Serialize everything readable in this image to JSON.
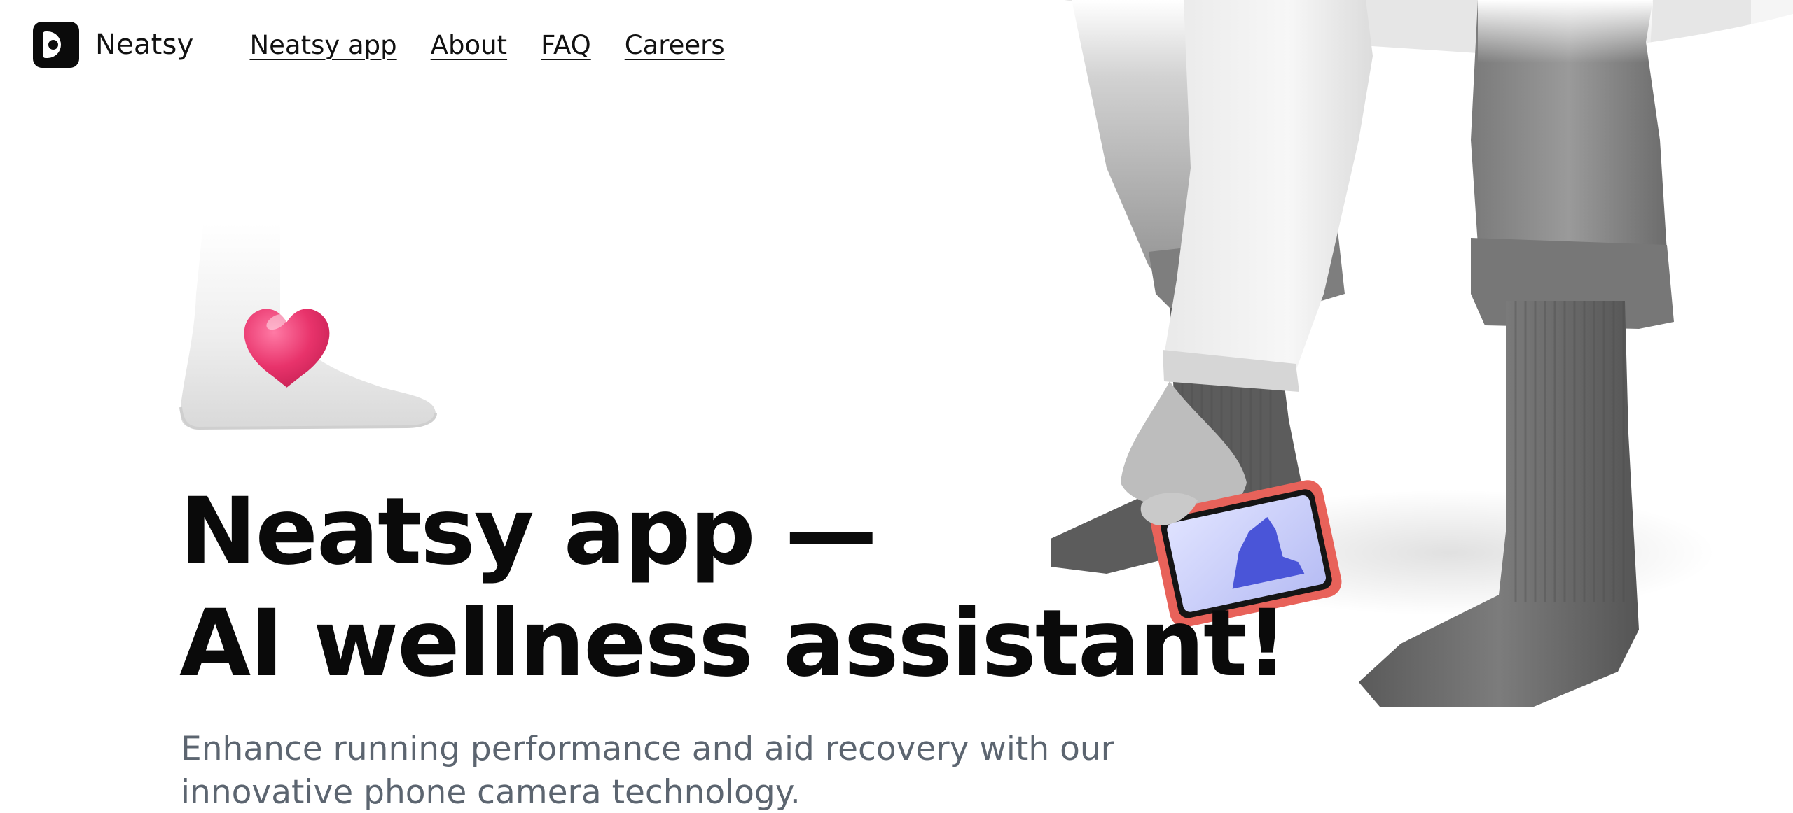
{
  "brand": {
    "name": "Neatsy",
    "logo_icon": "neatsy-logo-icon"
  },
  "nav": {
    "items": [
      {
        "label": "Neatsy app"
      },
      {
        "label": "About"
      },
      {
        "label": "FAQ"
      },
      {
        "label": "Careers"
      }
    ]
  },
  "hero": {
    "title_line1": "Neatsy app —",
    "title_line2": "AI wellness assistant!",
    "subtitle_line1": "Enhance running performance and aid recovery with our",
    "subtitle_line2": "innovative phone camera technology.",
    "illustration_icon": "foot-heart-icon",
    "photo_subject": "person-scanning-foot-with-phone"
  },
  "colors": {
    "heart": "#e8336b",
    "phone_case": "#e8625a",
    "scan_foot": "#4a55d8",
    "subtitle_text": "#5c6570",
    "headline_text": "#0a0a0a"
  }
}
